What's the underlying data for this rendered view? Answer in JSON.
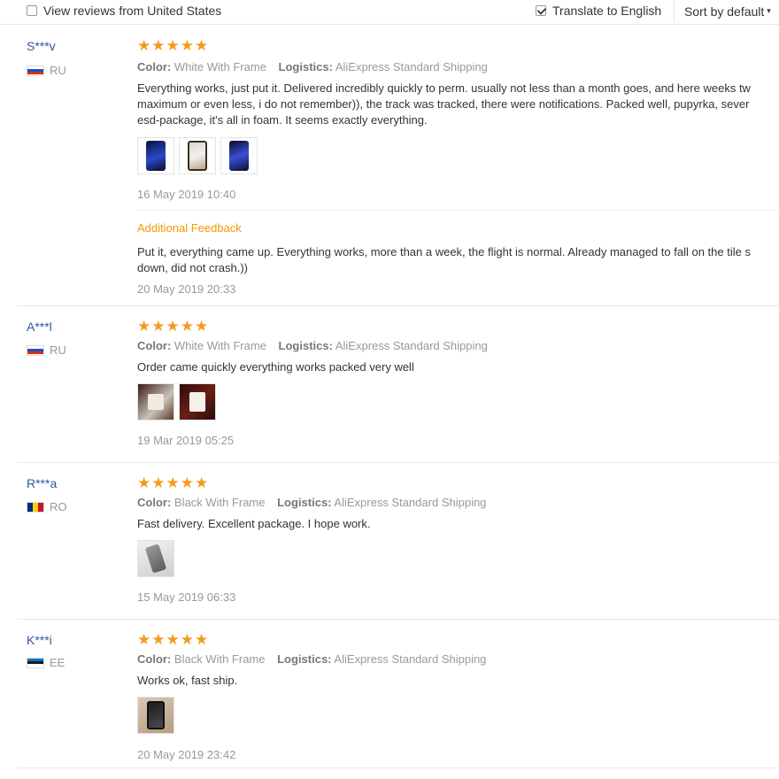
{
  "filters": {
    "local_label": "View reviews from United States",
    "local_checked": false,
    "translate_label": "Translate to English",
    "translate_checked": true,
    "sort_label": "Sort by default"
  },
  "reviews": [
    {
      "user": "S***v",
      "country": "RU",
      "stars": "★★★★★",
      "color_label": "Color:",
      "color_value": "White With Frame",
      "logistics_label": "Logistics:",
      "logistics_value": "AliExpress Standard Shipping",
      "text_lines": [
        "Everything works, just put it. Delivered incredibly quickly to perm. usually not less than a month goes, and here weeks tw",
        "maximum or even less, i do not remember)), the track was tracked, there were notifications. Packed well, pupyrka, sever",
        "esd-package, it's all in foam. It seems exactly everything."
      ],
      "date": "16 May 2019 10:40",
      "additional": {
        "heading": "Additional Feedback",
        "text_lines": [
          "Put it, everything came up. Everything works, more than a week, the flight is normal. Already managed to fall on the tile s",
          "down, did not crash.))"
        ],
        "date": "20 May 2019 20:33"
      }
    },
    {
      "user": "A***l",
      "country": "RU",
      "stars": "★★★★★",
      "color_label": "Color:",
      "color_value": "White With Frame",
      "logistics_label": "Logistics:",
      "logistics_value": "AliExpress Standard Shipping",
      "text_lines": [
        "Order came quickly everything works packed very well"
      ],
      "date": "19 Mar 2019 05:25"
    },
    {
      "user": "R***a",
      "country": "RO",
      "stars": "★★★★★",
      "color_label": "Color:",
      "color_value": "Black With Frame",
      "logistics_label": "Logistics:",
      "logistics_value": "AliExpress Standard Shipping",
      "text_lines": [
        "Fast delivery. Excellent package. I hope work."
      ],
      "date": "15 May 2019 06:33"
    },
    {
      "user": "K***i",
      "country": "EE",
      "stars": "★★★★★",
      "color_label": "Color:",
      "color_value": "Black With Frame",
      "logistics_label": "Logistics:",
      "logistics_value": "AliExpress Standard Shipping",
      "text_lines": [
        "Works ok, fast ship."
      ],
      "date": "20 May 2019 23:42"
    }
  ],
  "colors": {
    "username": "#2f55a4",
    "star": "#f49a1e",
    "additional_heading": "#f39800",
    "muted": "#999999"
  }
}
